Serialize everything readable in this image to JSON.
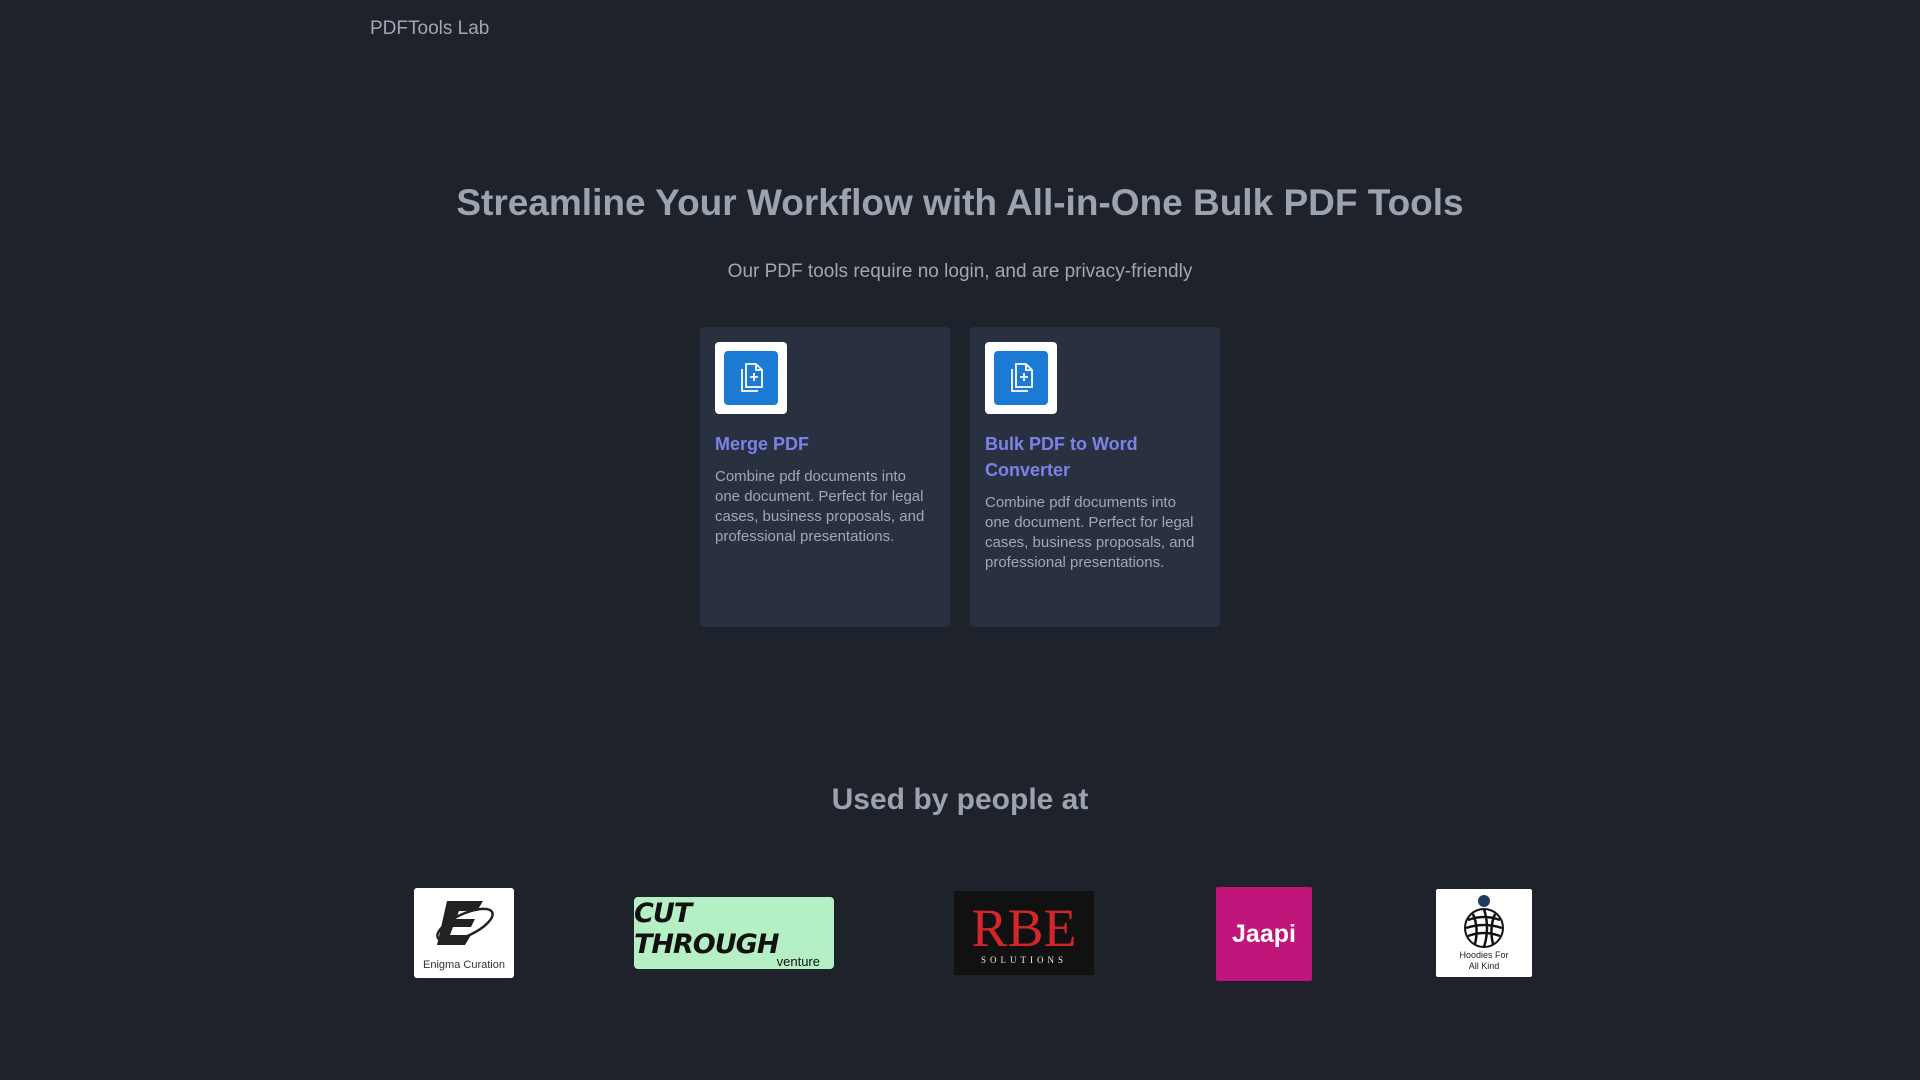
{
  "nav": {
    "brand": "PDFTools Lab"
  },
  "hero": {
    "title": "Streamline Your Workflow with All-in-One Bulk PDF Tools",
    "subtitle": "Our PDF tools require no login, and are privacy-friendly"
  },
  "tools": [
    {
      "icon": "file-add-icon",
      "title": "Merge PDF",
      "description": "Combine pdf documents into one document. Perfect for legal cases, business proposals, and professional presentations."
    },
    {
      "icon": "file-add-icon",
      "title": "Bulk PDF to Word Converter",
      "description": "Combine pdf documents into one document. Perfect for legal cases, business proposals, and professional presentations."
    }
  ],
  "customers": {
    "heading": "Used by people at",
    "logos": [
      {
        "name": "Enigma Curation",
        "mark": "E"
      },
      {
        "name": "Cut Through venture",
        "main": "CUT THROUGH",
        "sub": "venture"
      },
      {
        "name": "RBE Solutions",
        "main": "RBE",
        "sub": "SOLUTIONS"
      },
      {
        "name": "Jaapi",
        "main": "Jaapi"
      },
      {
        "name": "Hoodies For All Kind",
        "line1": "Hoodies For",
        "line2": "All Kind"
      }
    ]
  },
  "colors": {
    "background": "#1d222b",
    "card": "#293040",
    "accent_link": "#7c83e8",
    "icon_blue": "#1a7ad4"
  }
}
